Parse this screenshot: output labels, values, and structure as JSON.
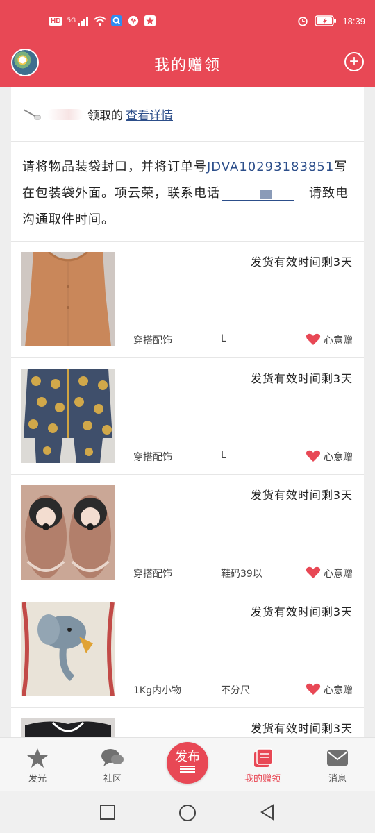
{
  "status_bar": {
    "hd": "HD",
    "network": "5G",
    "time": "18:39"
  },
  "header": {
    "title": "我的赠领",
    "add_icon": "plus-circle-icon",
    "accent": "#e84855"
  },
  "claim": {
    "text": "领取的",
    "link": "查看详情"
  },
  "notice": {
    "before": "请将物品装袋封口，并将订单号",
    "order_no": "JDVA10293183851",
    "middle": "写在包装袋外面。项云荣，联系电话",
    "after": "请致电沟通取件时间。"
  },
  "items": [
    {
      "deadline": "发货有效时间剩3天",
      "category": "穿搭配饰",
      "size": "L",
      "wish": "心意赠"
    },
    {
      "deadline": "发货有效时间剩3天",
      "category": "穿搭配饰",
      "size": "L",
      "wish": "心意赠"
    },
    {
      "deadline": "发货有效时间剩3天",
      "category": "穿搭配饰",
      "size": "鞋码39以",
      "wish": "心意赠"
    },
    {
      "deadline": "发货有效时间剩3天",
      "category": "1Kg内小物",
      "size": "不分尺",
      "wish": "心意赠"
    },
    {
      "deadline": "发货有效时间剩3天"
    }
  ],
  "bottom_nav": {
    "faguang": "发光",
    "community": "社区",
    "publish": "发布",
    "my_gifts": "我的赠领",
    "messages": "消息",
    "active": "my_gifts"
  }
}
